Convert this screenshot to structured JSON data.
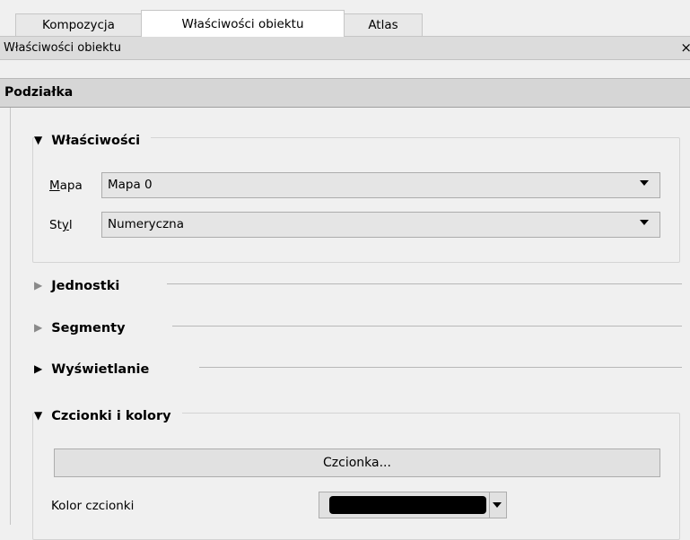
{
  "tabs": [
    {
      "label": "Kompozycja",
      "active": false
    },
    {
      "label": "Właściwości obiektu",
      "active": true
    },
    {
      "label": "Atlas",
      "active": false
    }
  ],
  "panel": {
    "title": "Właściwości obiektu",
    "close": "×"
  },
  "section": {
    "title": "Podziałka"
  },
  "groups": {
    "wlasciwosci": {
      "title": "Właściwości",
      "expanded": true
    },
    "jednostki": {
      "title": "Jednostki",
      "expanded": false
    },
    "segmenty": {
      "title": "Segmenty",
      "expanded": false
    },
    "wyswietlanie": {
      "title": "Wyświetlanie",
      "expanded": false
    },
    "czcionki": {
      "title": "Czcionki i kolory",
      "expanded": true
    }
  },
  "fields": {
    "mapa": {
      "label_mnemonic": "M",
      "label_rest": "apa",
      "value": "Mapa 0"
    },
    "styl": {
      "label_pre": "St",
      "label_mnemonic": "y",
      "label_rest": "l",
      "value": "Numeryczna"
    }
  },
  "font_button": {
    "label": "Czcionka..."
  },
  "font_color": {
    "label": "Kolor czcionki",
    "color": "#000000"
  },
  "icons": {
    "expanded": "▼",
    "collapsed": "▶",
    "dropdown": "chevron-down-icon"
  }
}
